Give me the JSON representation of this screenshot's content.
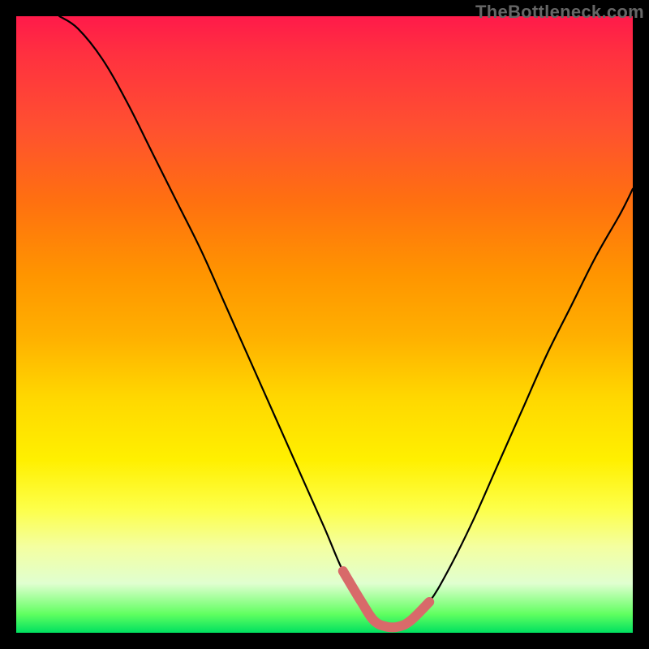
{
  "watermark": "TheBottleneck.com",
  "chart_data": {
    "type": "line",
    "title": "",
    "xlabel": "",
    "ylabel": "",
    "xlim": [
      0,
      100
    ],
    "ylim": [
      0,
      100
    ],
    "series": [
      {
        "name": "bottleneck-curve",
        "x": [
          7,
          10,
          14,
          18,
          22,
          26,
          30,
          34,
          38,
          42,
          46,
          50,
          53,
          56,
          58,
          60,
          62,
          64,
          67,
          70,
          74,
          78,
          82,
          86,
          90,
          94,
          98,
          100
        ],
        "values": [
          100,
          98,
          93,
          86,
          78,
          70,
          62,
          53,
          44,
          35,
          26,
          17,
          10,
          5,
          2,
          1,
          1,
          2,
          5,
          10,
          18,
          27,
          36,
          45,
          53,
          61,
          68,
          72
        ]
      }
    ],
    "highlight": {
      "name": "optimal-range",
      "color": "#d86a6a",
      "x": [
        53,
        56,
        58,
        60,
        62,
        64,
        67
      ],
      "values": [
        10,
        5,
        2,
        1,
        1,
        2,
        5
      ]
    },
    "background_gradient": {
      "top_color": "#ff1a4a",
      "mid_color": "#fff000",
      "bottom_color": "#00e060"
    }
  }
}
